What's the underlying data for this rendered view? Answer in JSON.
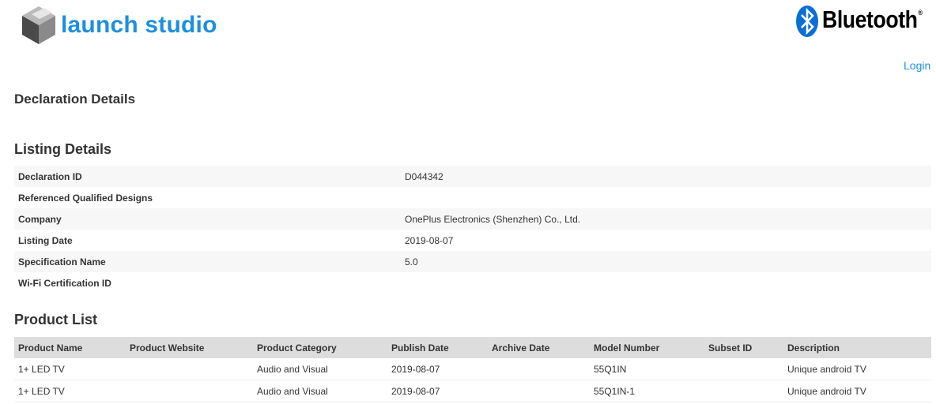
{
  "header": {
    "brand": "launch studio",
    "partner_logo": "Bluetooth",
    "partner_trademark": "®",
    "login_label": "Login",
    "brand_icon": "launch-studio-cube",
    "partner_icon": "bluetooth-rune",
    "colors": {
      "brand_blue": "#1e8fe0",
      "bluetooth_blue": "#0a6fd4"
    }
  },
  "sections": {
    "declaration_title": "Declaration Details",
    "listing_title": "Listing Details",
    "product_title": "Product List"
  },
  "listing": [
    {
      "label": "Declaration ID",
      "value": "D044342"
    },
    {
      "label": "Referenced Qualified Designs",
      "value": ""
    },
    {
      "label": "Company",
      "value": "OnePlus Electronics (Shenzhen) Co., Ltd."
    },
    {
      "label": "Listing Date",
      "value": "2019-08-07"
    },
    {
      "label": "Specification Name",
      "value": "5.0"
    },
    {
      "label": "Wi-Fi Certification ID",
      "value": ""
    }
  ],
  "products": {
    "columns": [
      "Product Name",
      "Product Website",
      "Product Category",
      "Publish Date",
      "Archive Date",
      "Model Number",
      "Subset ID",
      "Description"
    ],
    "rows": [
      [
        "1+ LED TV",
        "",
        "Audio and Visual",
        "2019-08-07",
        "",
        "55Q1IN",
        "",
        "Unique android TV"
      ],
      [
        "1+ LED TV",
        "",
        "Audio and Visual",
        "2019-08-07",
        "",
        "55Q1IN-1",
        "",
        "Unique android TV"
      ]
    ]
  }
}
